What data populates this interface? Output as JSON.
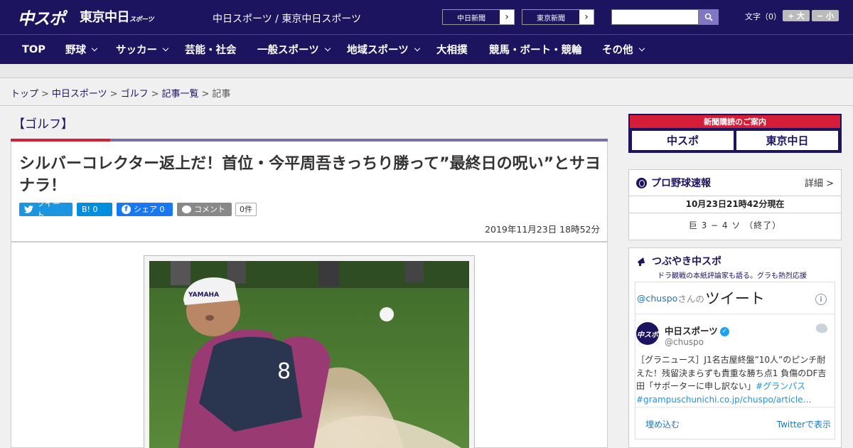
{
  "header": {
    "logo_chuspo": "中スポ",
    "logo_tokyo": "東京中日",
    "logo_tokyo_suffix": "スポーツ",
    "site_links": "中日スポーツ / 東京中日スポーツ",
    "paper_chunichi": "中日新聞",
    "paper_tokyo": "東京新聞",
    "search_placeholder": "",
    "font_label": "文字（0）",
    "font_larger": "+ 大",
    "font_smaller": "− 小"
  },
  "nav": {
    "items": [
      "TOP",
      "野球",
      "サッカー",
      "芸能・社会",
      "一般スポーツ",
      "地域スポーツ",
      "大相撲",
      "競馬・ボート・競輪",
      "その他"
    ]
  },
  "breadcrumb": {
    "items": [
      "トップ",
      "中日スポーツ",
      "ゴルフ",
      "記事一覧"
    ],
    "current": "記事",
    "separator": ">"
  },
  "article": {
    "section": "【ゴルフ】",
    "title": "シルバーコレクター返上だ！首位・今平周吾きっちり勝って”最終日の呪い”とサヨナラ！",
    "share": {
      "tweet": "ツイート",
      "hatena": "B! 0",
      "facebook": "シェア 0",
      "comment": "コメント",
      "comment_count": "0件"
    },
    "date": "2019年11月23日 18時52分"
  },
  "sidebar": {
    "ad": {
      "top": "新聞購読のご案内",
      "chuspo": "中スポ",
      "tokyo": "東京中日"
    },
    "baseball": {
      "title": "プロ野球速報",
      "detail": "詳細 >",
      "updated": "10月23日21時42分現在",
      "score": "巨 3 − 4 ソ （終了）"
    },
    "tsubuyaki": {
      "title": "つぶやき中スポ",
      "subtitle": "ドラ観戦の本紙評論家も語る。グラも熱烈応援",
      "handle_prefix": "@chuspo",
      "handle_suffix": "さんの",
      "tweets_label": "ツイート",
      "account_name": "中日スポーツ",
      "account_handle": "@chuspo",
      "tweet_text": "［グラニュース］J1名古屋終盤”10人”のピンチ耐えた！残留決まらずも貴重な勝ち点1 負傷のDF吉田「サポーターに申し訳ない」",
      "tag1": "#グランパス",
      "tag2": "#grampuschunichi.co.jp/chuspo/article…",
      "embed": "埋め込む",
      "view_on_twitter": "Twitterで表示"
    }
  },
  "colors": {
    "brand_navy": "#1d1460",
    "accent_red": "#d51d38",
    "accent_purple": "#7670b1",
    "twitter_blue": "#1b95e0"
  }
}
